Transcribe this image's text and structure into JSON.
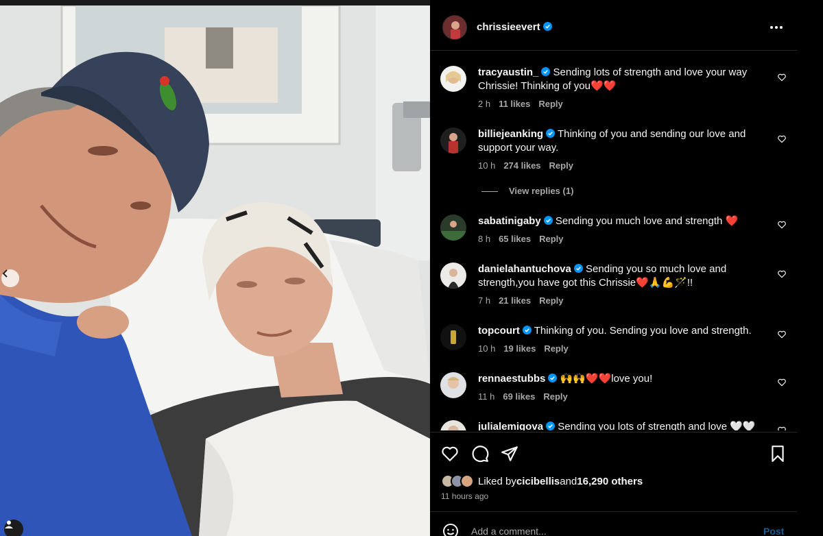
{
  "post": {
    "owner": "chrissieevert",
    "owner_verified": true
  },
  "comments": [
    {
      "user": "tracyaustin_",
      "verified": true,
      "text": "Sending lots of strength and love your way Chrissie! Thinking of you❤️❤️",
      "time": "2 h",
      "likes": "11 likes",
      "reply": "Reply",
      "avatar_color": "#e3c79a"
    },
    {
      "user": "billiejeanking",
      "verified": true,
      "text": "Thinking of you and sending our love and support your way.",
      "time": "10 h",
      "likes": "274 likes",
      "reply": "Reply",
      "view_replies": "View replies (1)",
      "avatar_color": "#b8322e"
    },
    {
      "user": "sabatinigaby",
      "verified": true,
      "text": "Sending you much love and strength ❤️",
      "time": "8 h",
      "likes": "65 likes",
      "reply": "Reply",
      "avatar_color": "#3e6b3a"
    },
    {
      "user": "danielahantuchova",
      "verified": true,
      "text": "Sending you so much love and strength,you have got this Chrissie❤️🙏💪🪄!!",
      "time": "7 h",
      "likes": "21 likes",
      "reply": "Reply",
      "avatar_color": "#d8d4cf"
    },
    {
      "user": "topcourt",
      "verified": true,
      "text": "Thinking of you. Sending you love and strength.",
      "time": "10 h",
      "likes": "19 likes",
      "reply": "Reply",
      "avatar_color": "#c7a63c"
    },
    {
      "user": "rennaestubbs",
      "verified": true,
      "text": "🙌🙌❤️❤️love you!",
      "time": "11 h",
      "likes": "69 likes",
      "reply": "Reply",
      "avatar_color": "#cfd2d6"
    },
    {
      "user": "julialemigova",
      "verified": true,
      "text": "Sending you lots of strength and love 🤍🤍",
      "avatar_color": "#bfb7ad"
    }
  ],
  "actions": {
    "liked_prefix": "Liked by ",
    "liked_user": "cicibellis",
    "liked_mid": " and ",
    "liked_count": "16,290 others",
    "time_ago": "11 hours ago"
  },
  "composer": {
    "placeholder": "Add a comment...",
    "post_label": "Post"
  },
  "icons": {
    "verified": "verified-badge-icon",
    "more": "more-options-icon",
    "like": "heart-icon",
    "comment": "comment-bubble-icon",
    "share": "paper-plane-icon",
    "save": "bookmark-icon",
    "emoji": "smiley-icon",
    "prev": "chevron-left-icon",
    "tag": "person-tag-icon"
  },
  "colors": {
    "background": "#000000",
    "verified_blue": "#0095f6",
    "muted_text": "#a8a8a8",
    "divider": "#262626"
  }
}
